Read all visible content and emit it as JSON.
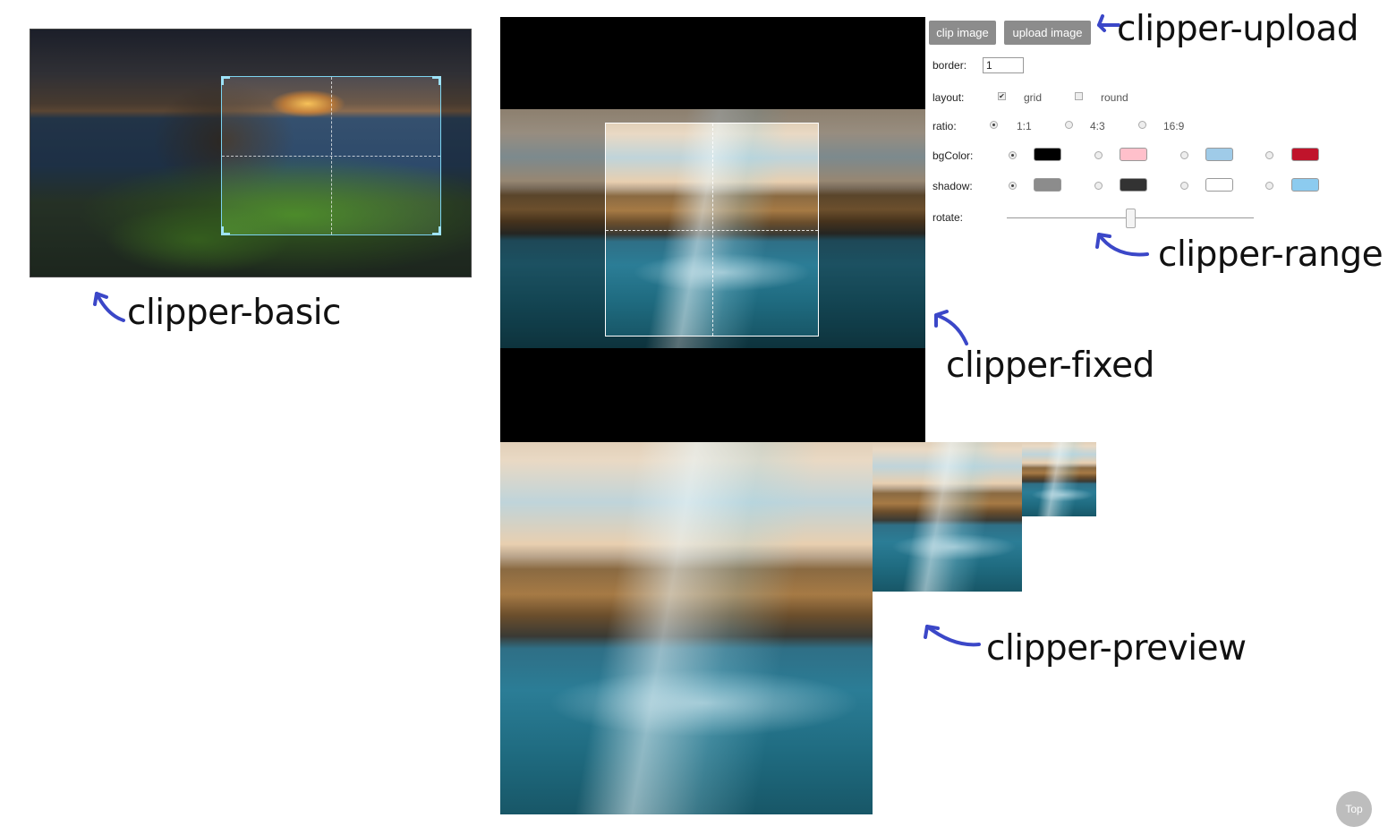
{
  "toolbar": {
    "clip_label": "clip image",
    "upload_label": "upload image"
  },
  "border": {
    "label": "border:",
    "value": "1"
  },
  "layout": {
    "label": "layout:",
    "options": [
      {
        "label": "grid",
        "checked": true
      },
      {
        "label": "round",
        "checked": false
      }
    ]
  },
  "ratio": {
    "label": "ratio:",
    "options": [
      {
        "label": "1:1",
        "selected": true
      },
      {
        "label": "4:3",
        "selected": false
      },
      {
        "label": "16:9",
        "selected": false
      }
    ]
  },
  "bgColor": {
    "label": "bgColor:",
    "options": [
      {
        "color": "#000000",
        "selected": true
      },
      {
        "color": "#ffc0cb",
        "selected": false
      },
      {
        "color": "#9fcbe8",
        "selected": false
      },
      {
        "color": "#c0142b",
        "selected": false
      }
    ]
  },
  "shadow": {
    "label": "shadow:",
    "options": [
      {
        "color": "#8c8c8c",
        "selected": true
      },
      {
        "color": "#333333",
        "selected": false
      },
      {
        "color": "#ffffff",
        "selected": false
      },
      {
        "color": "#8ccbef",
        "selected": false
      }
    ]
  },
  "rotate": {
    "label": "rotate:",
    "value": 0.5
  },
  "annotations": {
    "basic": "clipper-basic",
    "upload": "clipper-upload",
    "range": "clipper-range",
    "fixed": "clipper-fixed",
    "preview": "clipper-preview"
  },
  "annotation_color": "#3b47c8",
  "back_to_top": "Top"
}
